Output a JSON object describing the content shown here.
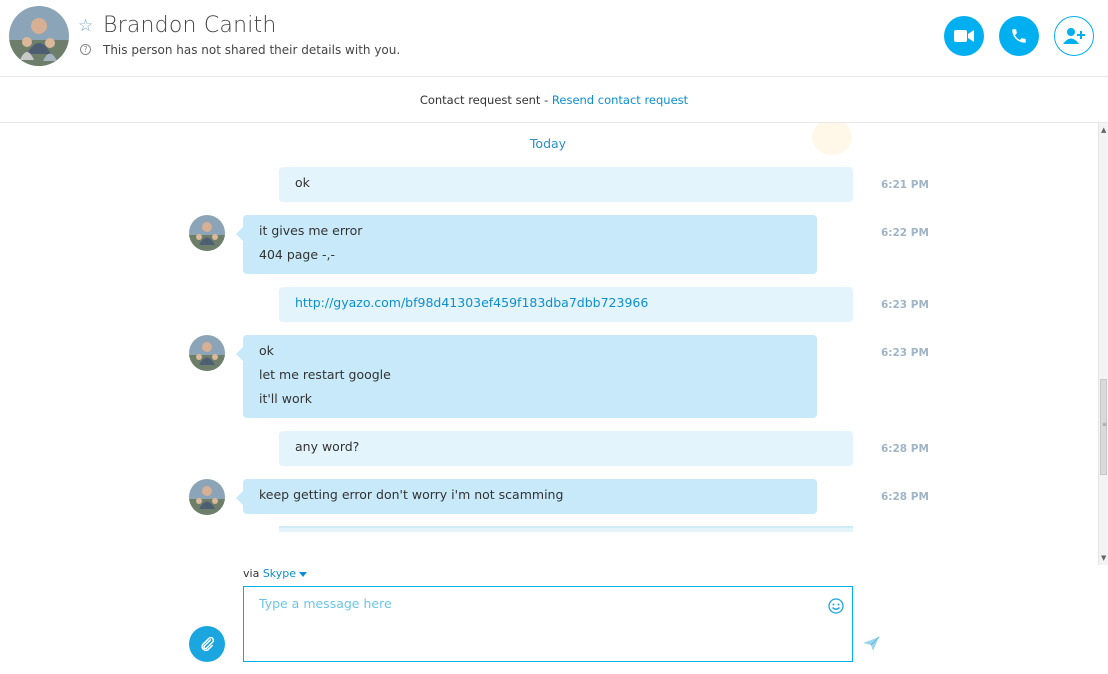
{
  "header": {
    "contact_name": "Brandon Canith",
    "details_text": "This person has not shared their details with you.",
    "buttons": {
      "video": "video-call-icon",
      "call": "phone-icon",
      "add": "add-contact-icon"
    }
  },
  "request_bar": {
    "status": "Contact request sent - ",
    "link": "Resend contact request"
  },
  "chat": {
    "date_separator": "Today",
    "messages": [
      {
        "direction": "outgoing",
        "lines": [
          "ok"
        ],
        "time": "6:21 PM"
      },
      {
        "direction": "incoming",
        "lines": [
          "it gives me error",
          "404 page -,-"
        ],
        "time": "6:22 PM"
      },
      {
        "direction": "outgoing",
        "lines": [
          "http://gyazo.com/bf98d41303ef459f183dba7dbb723966"
        ],
        "time": "6:23 PM",
        "is_link": true
      },
      {
        "direction": "incoming",
        "lines": [
          "ok",
          "let me restart google",
          "it'll work"
        ],
        "time": "6:23 PM"
      },
      {
        "direction": "outgoing",
        "lines": [
          "any word?"
        ],
        "time": "6:28 PM"
      },
      {
        "direction": "incoming",
        "lines": [
          "keep getting error don't worry i'm not scamming"
        ],
        "time": "6:28 PM"
      }
    ]
  },
  "composer": {
    "via_label": "via",
    "via_service": "Skype",
    "placeholder": "Type a message here",
    "value": ""
  },
  "colors": {
    "accent": "#00aff0",
    "link": "#0d8fcf",
    "incoming_bubble": "#c7e9f9",
    "outgoing_bubble": "#e3f4fc",
    "timestamp": "#9fb5c7"
  }
}
